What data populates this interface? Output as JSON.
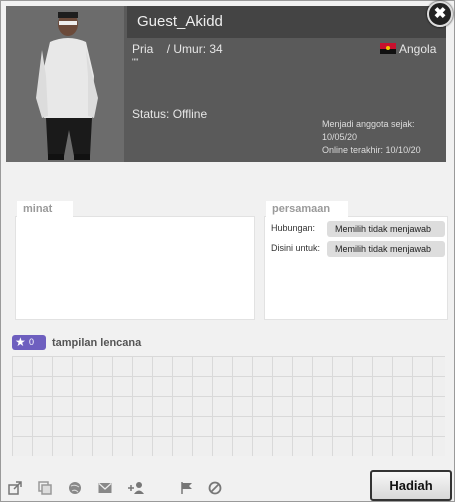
{
  "profile": {
    "username": "Guest_Akidd",
    "gender": "Pria",
    "age_label": "/ Umur:",
    "age": "34",
    "tagline": "\"\"",
    "country": "Angola",
    "status": "Status: Offline",
    "member_since_label": "Menjadi anggota sejak:",
    "member_since": "10/05/20",
    "last_online_label": "Online terakhir:",
    "last_online": "10/10/20"
  },
  "sections": {
    "interests_title": "minat",
    "matches_title": "persamaan",
    "relationship_label": "Hubungan:",
    "relationship_value": "Memilih tidak menjawab",
    "here_for_label": "Disini untuk:",
    "here_for_value": "Memilih tidak menjawab"
  },
  "badges": {
    "count": "0",
    "title": "tampilan lencana"
  },
  "actions": {
    "gift_label": "Hadiah",
    "close_glyph": "✖"
  },
  "icons": [
    "share-icon",
    "copy-icon",
    "globe-icon",
    "mail-icon",
    "add-friend-icon",
    "flag-icon",
    "block-icon"
  ],
  "colors": {
    "header_bg": "#5a5a5a",
    "name_bar_bg": "#444444",
    "badge_purple": "#6e5fbf"
  }
}
